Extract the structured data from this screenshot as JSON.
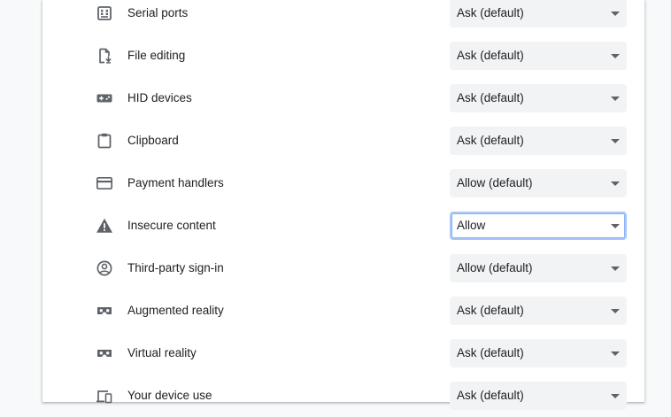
{
  "permissions": [
    {
      "label": "Serial ports",
      "value": "Ask (default)",
      "icon": "serial-port-icon"
    },
    {
      "label": "File editing",
      "value": "Ask (default)",
      "icon": "file-edit-icon"
    },
    {
      "label": "HID devices",
      "value": "Ask (default)",
      "icon": "gamepad-icon"
    },
    {
      "label": "Clipboard",
      "value": "Ask (default)",
      "icon": "clipboard-icon"
    },
    {
      "label": "Payment handlers",
      "value": "Allow (default)",
      "icon": "credit-card-icon"
    },
    {
      "label": "Insecure content",
      "value": "Allow",
      "icon": "warning-icon"
    },
    {
      "label": "Third-party sign-in",
      "value": "Allow (default)",
      "icon": "account-circle-icon"
    },
    {
      "label": "Augmented reality",
      "value": "Ask (default)",
      "icon": "vr-headset-icon"
    },
    {
      "label": "Virtual reality",
      "value": "Ask (default)",
      "icon": "vr-headset-icon"
    },
    {
      "label": "Your device use",
      "value": "Ask (default)",
      "icon": "devices-icon"
    }
  ],
  "colors": {
    "text": "#202124",
    "icon": "#5f6368",
    "select_bg": "#f1f3f4",
    "focus_border": "#a8c7fa"
  }
}
